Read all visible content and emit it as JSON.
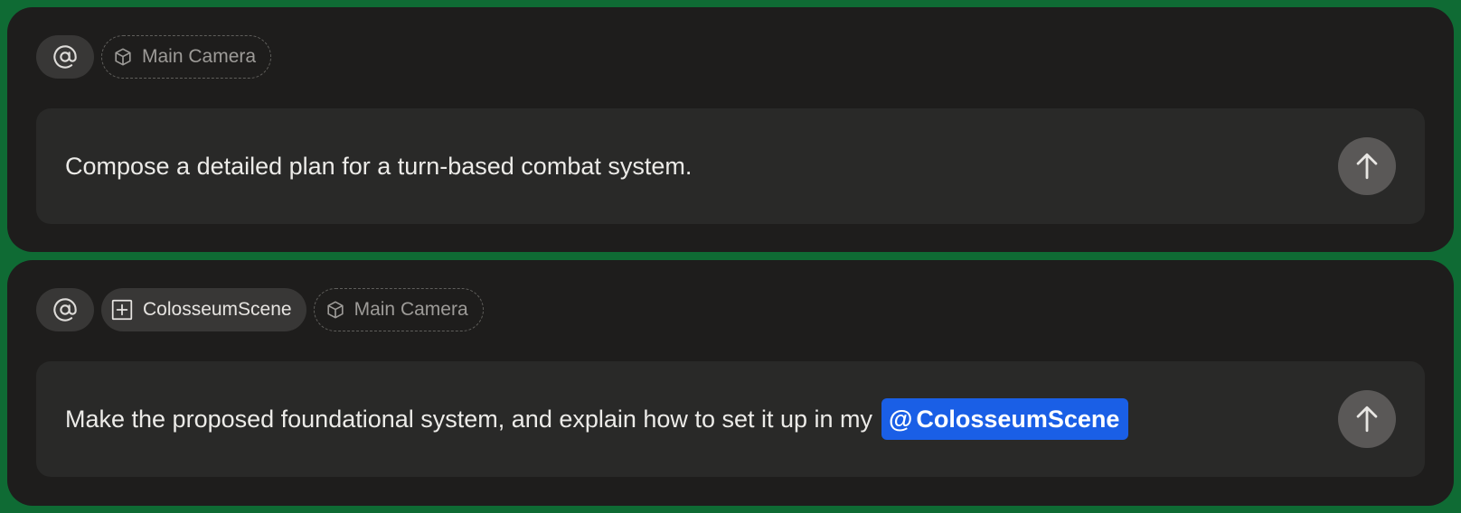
{
  "colors": {
    "background": "#0f6b34",
    "panel": "#1e1d1c",
    "input": "#292928",
    "mention": "#1a5fe6"
  },
  "panels": [
    {
      "at_icon": "at-sign-icon",
      "chips": [
        {
          "icon": "cube-icon",
          "label": "Main Camera",
          "style": "dashed"
        }
      ],
      "prompt": "Compose a detailed plan for a turn-based combat system.",
      "send_icon": "arrow-up-icon"
    },
    {
      "at_icon": "at-sign-icon",
      "chips": [
        {
          "icon": "scene-plus-icon",
          "label": "ColosseumScene",
          "style": "solid"
        },
        {
          "icon": "cube-icon",
          "label": "Main Camera",
          "style": "dashed"
        }
      ],
      "prompt": "Make the proposed foundational system, and explain how to set it up in my",
      "mention": {
        "at": "@",
        "label": "ColosseumScene"
      },
      "send_icon": "arrow-up-icon"
    }
  ]
}
